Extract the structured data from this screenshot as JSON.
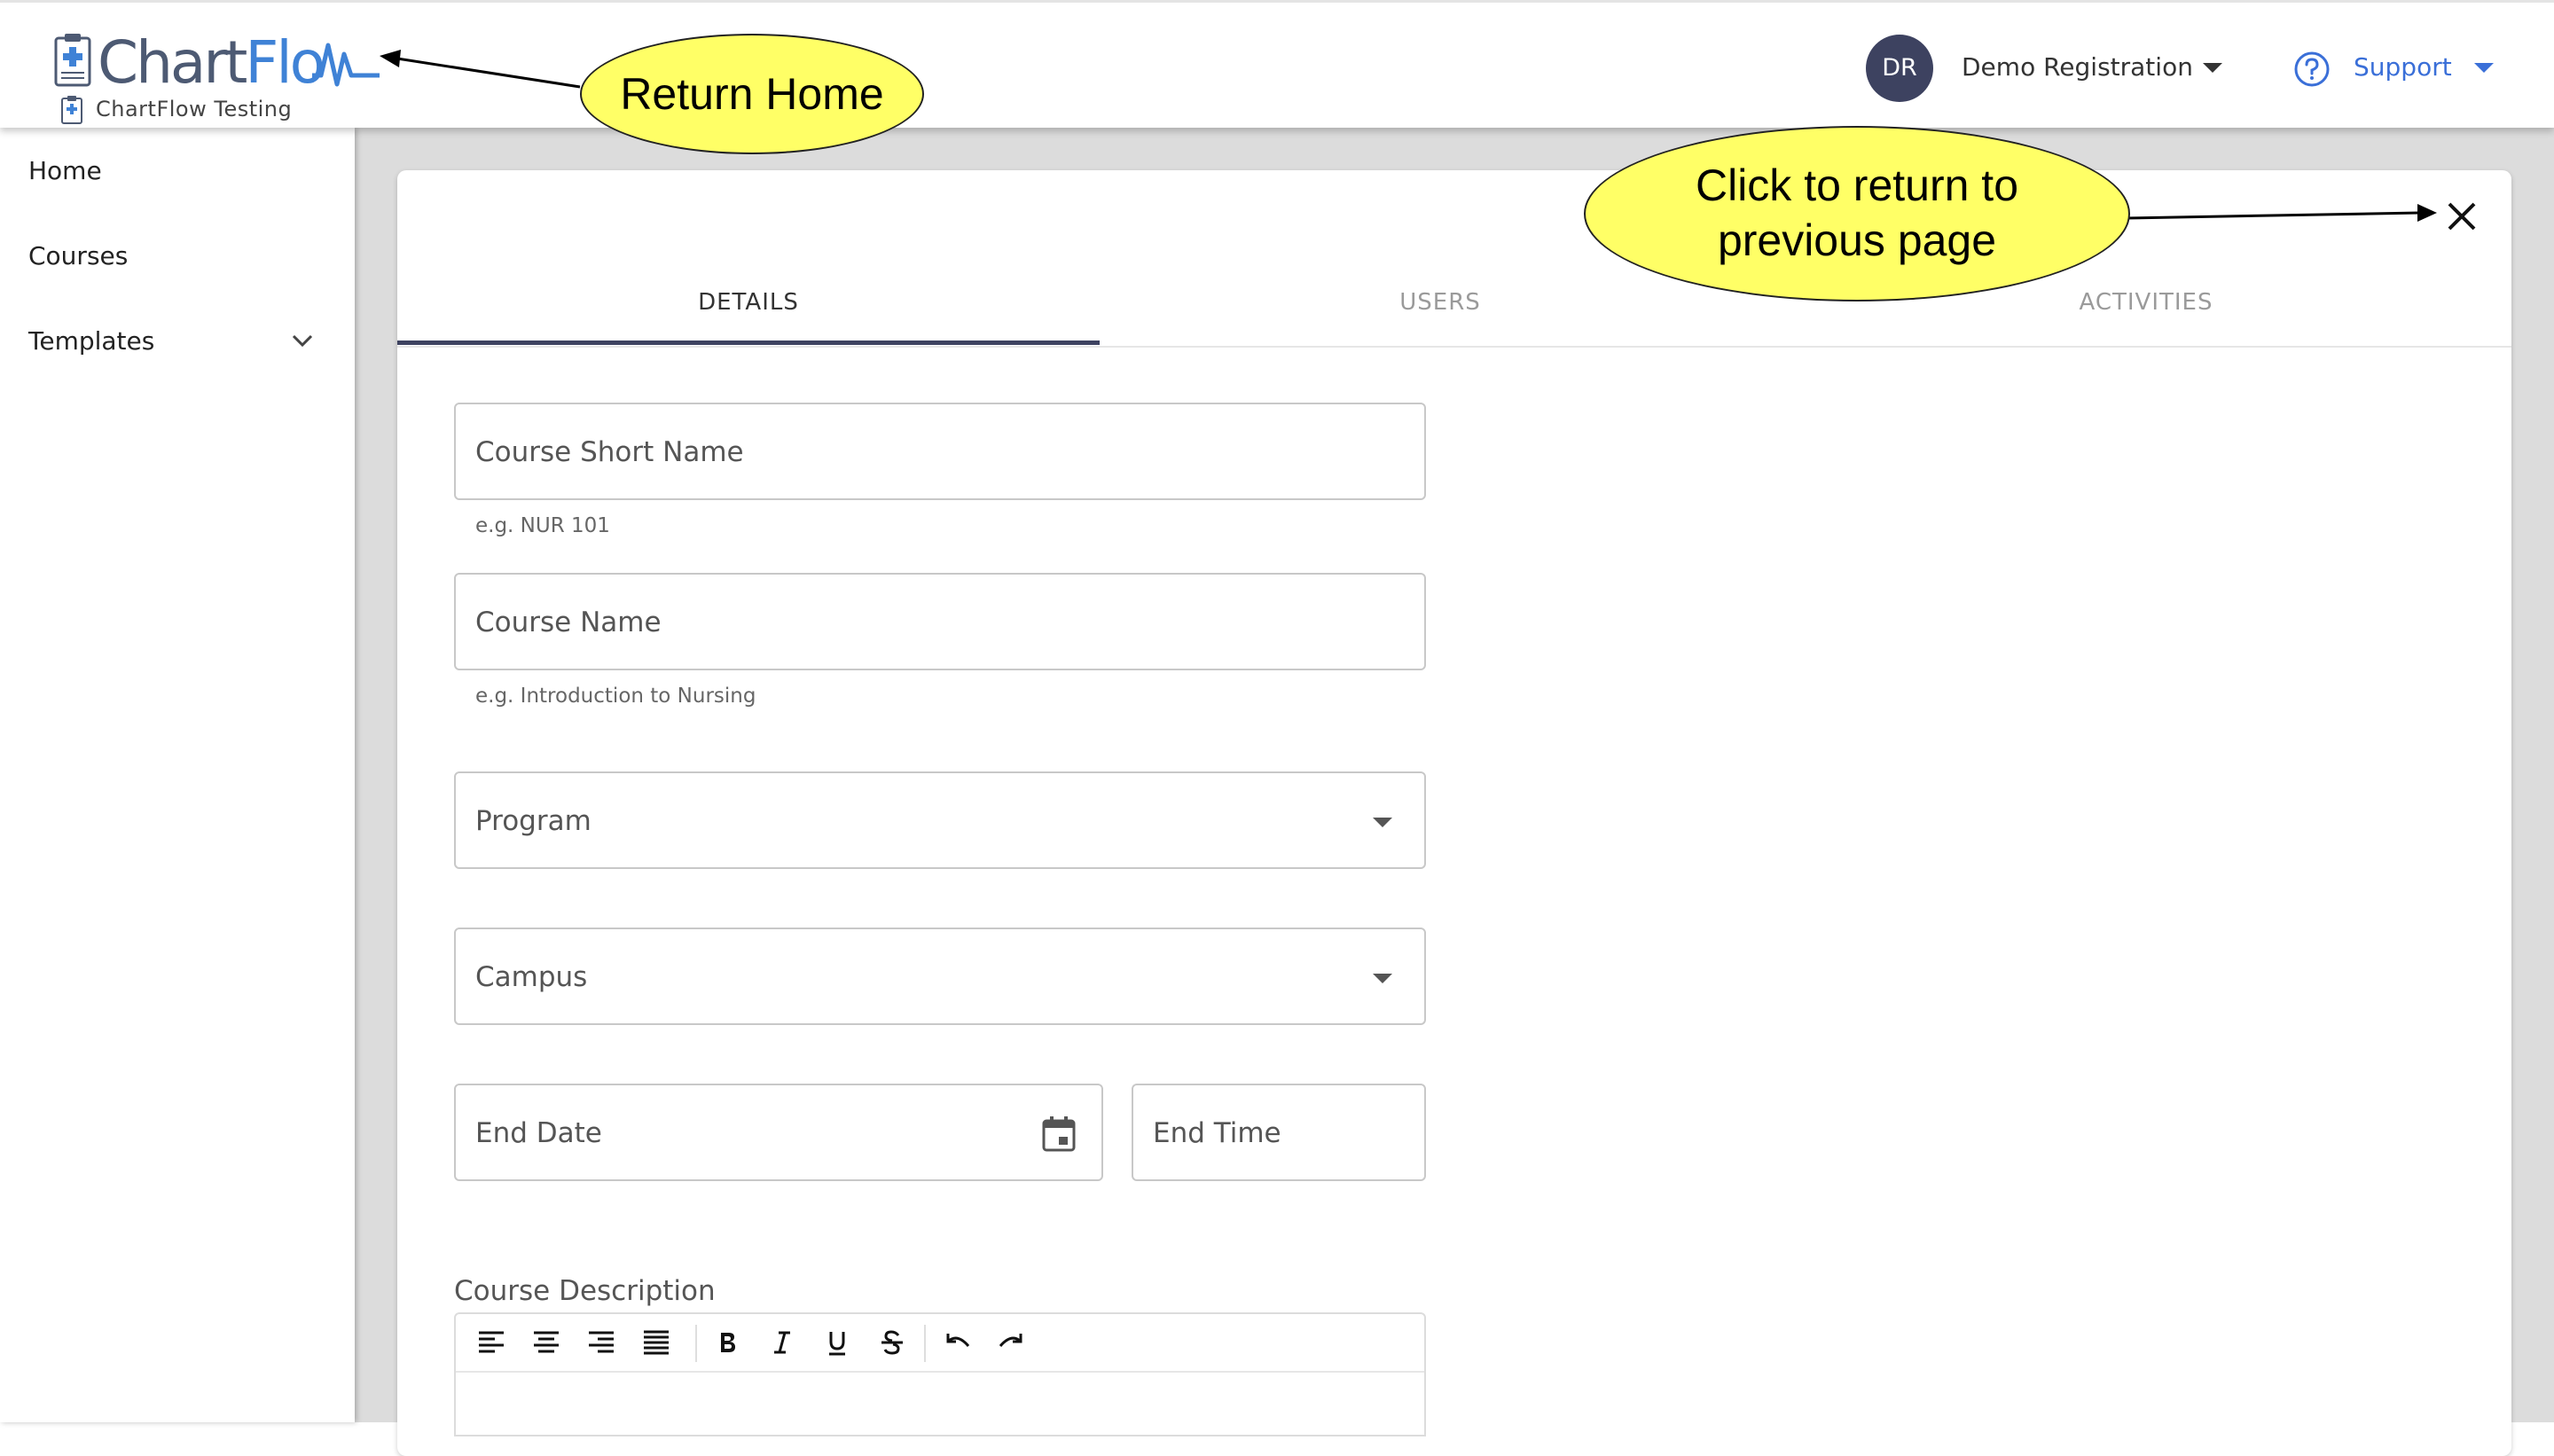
{
  "header": {
    "brand": {
      "word1": "Chart",
      "word2": "Flo",
      "sub_label": "ChartFlow Testing"
    },
    "user": {
      "initials": "DR",
      "name": "Demo Registration"
    },
    "support": {
      "label": "Support"
    }
  },
  "sidebar": {
    "items": [
      {
        "label": "Home"
      },
      {
        "label": "Courses"
      },
      {
        "label": "Templates"
      }
    ]
  },
  "tabs": [
    {
      "label": "DETAILS",
      "active": true
    },
    {
      "label": "USERS",
      "active": false
    },
    {
      "label": "ACTIVITIES",
      "active": false
    }
  ],
  "form": {
    "short_name": {
      "placeholder": "Course Short Name",
      "hint": "e.g. NUR 101"
    },
    "name": {
      "placeholder": "Course Name",
      "hint": "e.g. Introduction to Nursing"
    },
    "program": {
      "placeholder": "Program"
    },
    "campus": {
      "placeholder": "Campus"
    },
    "end_date": {
      "placeholder": "End Date"
    },
    "end_time": {
      "placeholder": "End Time"
    },
    "description": {
      "label": "Course Description"
    }
  },
  "editor_toolbar": [
    "align-left-icon",
    "align-center-icon",
    "align-right-icon",
    "align-justify-icon",
    "bold-icon",
    "italic-icon",
    "underline-icon",
    "strikethrough-icon",
    "undo-icon",
    "redo-icon"
  ],
  "callouts": {
    "home": "Return Home",
    "close_line1": "Click to return to",
    "close_line2": "previous page"
  },
  "colors": {
    "accent": "#3d4260",
    "link": "#3a6fd8",
    "callout": "#ffff66",
    "page_bg": "#dcdcdc"
  }
}
